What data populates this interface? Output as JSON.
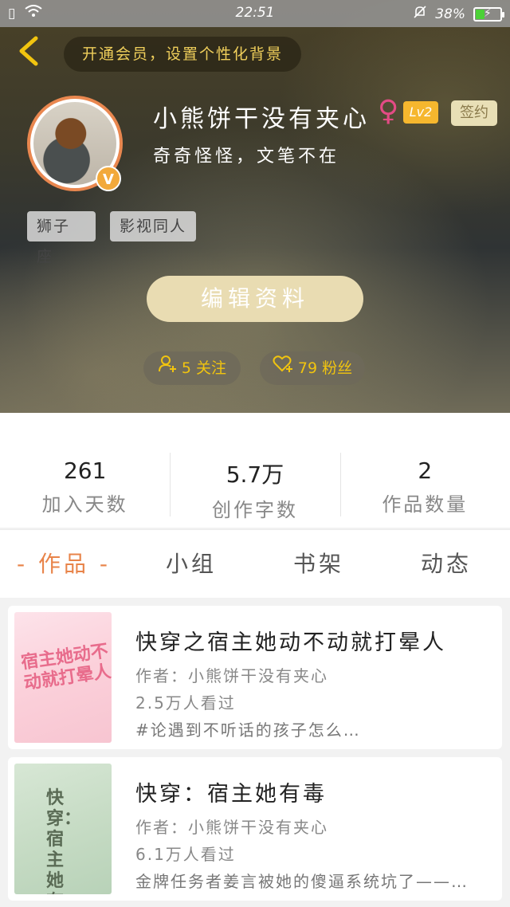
{
  "status_bar": {
    "time": "22:51",
    "battery_percent": "38%",
    "battery_level": 0.38,
    "icons": [
      "sim-icon",
      "wifi-icon",
      "mute-bell-icon",
      "battery-icon"
    ]
  },
  "header": {
    "back_icon": "chevron-left-icon",
    "vip_banner": "开通会员，设置个性化背景"
  },
  "profile": {
    "name": "小熊饼干没有夹心",
    "gender_symbol": "♀",
    "level": "Lv2",
    "signed_label": "签约",
    "verified_badge": "V",
    "bio": "奇奇怪怪，文笔不在",
    "tags": [
      "狮子座",
      "影视同人"
    ],
    "edit_button": "编辑资料",
    "following": "5 关注",
    "followers": "79 粉丝"
  },
  "stats": [
    {
      "value": "261",
      "label": "加入天数"
    },
    {
      "value": "5.7万",
      "label": "创作字数"
    },
    {
      "value": "2",
      "label": "作品数量"
    }
  ],
  "tabs": [
    {
      "label": "- 作品 -",
      "active": true
    },
    {
      "label": "小组",
      "active": false
    },
    {
      "label": "书架",
      "active": false
    },
    {
      "label": "动态",
      "active": false
    }
  ],
  "works": [
    {
      "title": "快穿之宿主她动不动就打晕人",
      "author": "作者：小熊饼干没有夹心",
      "views": "2.5万人看过",
      "desc": "#论遇到不听话的孩子怎么…",
      "cover_text": "宿主她动不动就打晕人"
    },
    {
      "title": "快穿：宿主她有毒",
      "author": "作者：小熊饼干没有夹心",
      "views": "6.1万人看过",
      "desc": "金牌任务者姜言被她的傻逼系统坑了——…",
      "cover_text": "快穿：宿主她有毒"
    }
  ],
  "colors": {
    "accent": "#e8844a",
    "gold": "#f1c40f",
    "edit_button": "#e9dcb2",
    "level_badge": "#f6b72e",
    "female": "#e34b85"
  }
}
